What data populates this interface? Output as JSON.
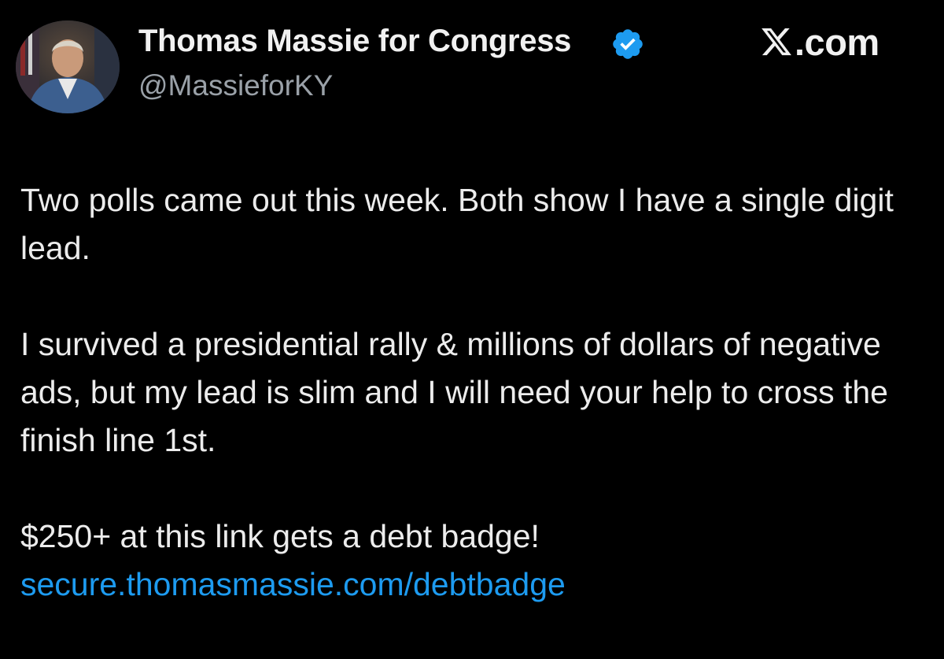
{
  "author": {
    "display_name": "Thomas Massie for Congress",
    "handle": "@MassieforKY",
    "verified": true
  },
  "brand": {
    "logo_icon": "x-logo-icon",
    "label": ".com"
  },
  "tweet": {
    "paragraph_1": "Two polls came out this week. Both show I have a single digit lead.",
    "paragraph_2": "I survived a presidential rally & millions of dollars of negative ads, but my lead is slim and I will need your help to cross the finish line 1st.",
    "paragraph_3": "$250+ at this link gets a debt badge!",
    "link_text": "secure.thomasmassie.com/debtbadge"
  },
  "colors": {
    "background": "#000000",
    "text": "#e7e9ea",
    "secondary_text": "#9aa1a8",
    "link": "#1d9bf0",
    "verified_badge": "#1d9bf0"
  }
}
